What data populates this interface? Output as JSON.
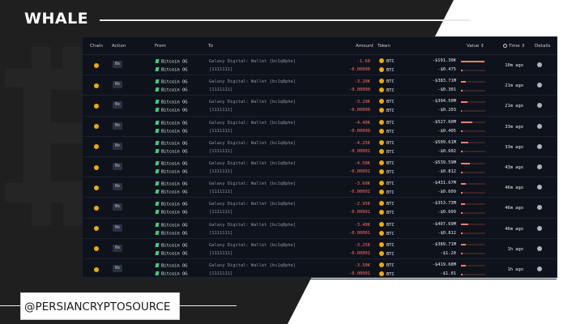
{
  "brand": "WHALE",
  "handle": "@PERSIANCRYPTOSOURCE",
  "columns": {
    "chain": "Chain",
    "action": "Action",
    "from": "From",
    "to": "To",
    "amount": "Amount",
    "token": "Token",
    "value": "Value ⇕",
    "time": "Time ⇕",
    "details": "Details"
  },
  "colors": {
    "accent_btc": "#f2a900",
    "negative": "#ff6b6b",
    "panel": "#0e131b"
  },
  "rows": [
    {
      "action": "0x",
      "from1": "Bitcoin OG",
      "from2": "Bitcoin OG",
      "to1": "Galaxy Digital: Wallet [bc1q8phe]",
      "to2": "[1111111]",
      "amt1": "-1.60",
      "amt2": "-0.00000",
      "tok1": "BTC",
      "tok2": "BTC",
      "val1": "-$191.30K",
      "val2": "-$0.475",
      "bar1": 0.95,
      "bar2": 0.05,
      "time": "10m ago"
    },
    {
      "action": "0x",
      "from1": "Bitcoin OG",
      "from2": "Bitcoin OG",
      "to1": "Galaxy Digital: Wallet [bc1q8phe]",
      "to2": "[1111111]",
      "amt1": "-3.20K",
      "amt2": "-0.00000",
      "tok1": "BTC",
      "tok2": "BTC",
      "val1": "-$383.71M",
      "val2": "-$0.301",
      "bar1": 0.2,
      "bar2": 0.05,
      "time": "21m ago"
    },
    {
      "action": "0x",
      "from1": "Bitcoin OG",
      "from2": "Bitcoin OG",
      "to1": "Galaxy Digital: Wallet [bc1q8phe]",
      "to2": "[1111111]",
      "amt1": "-3.29K",
      "amt2": "-0.00000",
      "tok1": "BTC",
      "tok2": "BTC",
      "val1": "-$394.50M",
      "val2": "-$0.203",
      "bar1": 0.25,
      "bar2": 0.04,
      "time": "21m ago"
    },
    {
      "action": "0x",
      "from1": "Bitcoin OG",
      "from2": "Bitcoin OG",
      "to1": "Galaxy Digital: Wallet [bc1q8phe]",
      "to2": "[1111111]",
      "amt1": "-4.40K",
      "amt2": "-0.00000",
      "tok1": "BTC",
      "tok2": "BTC",
      "val1": "-$527.60M",
      "val2": "-$0.405",
      "bar1": 0.45,
      "bar2": 0.05,
      "time": "33m ago"
    },
    {
      "action": "0x",
      "from1": "Bitcoin OG",
      "from2": "Bitcoin OG",
      "to1": "Galaxy Digital: Wallet [bc1q8phe]",
      "to2": "[1111111]",
      "amt1": "-4.25K",
      "amt2": "-0.00001",
      "tok1": "BTC",
      "tok2": "BTC",
      "val1": "-$509.61M",
      "val2": "-$0.602",
      "bar1": 0.3,
      "bar2": 0.05,
      "time": "33m ago"
    },
    {
      "action": "0x",
      "from1": "Bitcoin OG",
      "from2": "Bitcoin OG",
      "to1": "Galaxy Digital: Wallet [bc1q8phe]",
      "to2": "[1111111]",
      "amt1": "-4.50K",
      "amt2": "-0.00001",
      "tok1": "BTC",
      "tok2": "BTC",
      "val1": "-$539.59M",
      "val2": "-$0.812",
      "bar1": 0.35,
      "bar2": 0.05,
      "time": "43m ago"
    },
    {
      "action": "0x",
      "from1": "Bitcoin OG",
      "from2": "Bitcoin OG",
      "to1": "Galaxy Digital: Wallet [bc1q8phe]",
      "to2": "[1111111]",
      "amt1": "-3.60K",
      "amt2": "-0.00001",
      "tok1": "BTC",
      "tok2": "BTC",
      "val1": "-$431.67M",
      "val2": "-$0.609",
      "bar1": 0.2,
      "bar2": 0.05,
      "time": "46m ago"
    },
    {
      "action": "0x",
      "from1": "Bitcoin OG",
      "from2": "Bitcoin OG",
      "to1": "Galaxy Digital: Wallet [bc1q8phe]",
      "to2": "[1111111]",
      "amt1": "-2.95K",
      "amt2": "-0.00001",
      "tok1": "BTC",
      "tok2": "BTC",
      "val1": "-$353.73M",
      "val2": "-$0.609",
      "bar1": 0.15,
      "bar2": 0.05,
      "time": "46m ago"
    },
    {
      "action": "0x",
      "from1": "Bitcoin OG",
      "from2": "Bitcoin OG",
      "to1": "Galaxy Digital: Wallet [bc1q8phe]",
      "to2": "[1111111]",
      "amt1": "-3.40K",
      "amt2": "-0.00001",
      "tok1": "BTC",
      "tok2": "BTC",
      "val1": "-$407.69M",
      "val2": "-$0.812",
      "bar1": 0.3,
      "bar2": 0.05,
      "time": "46m ago"
    },
    {
      "action": "0x",
      "from1": "Bitcoin OG",
      "from2": "Bitcoin OG",
      "to1": "Galaxy Digital: Wallet [bc1q8phe]",
      "to2": "[1111111]",
      "amt1": "-3.25K",
      "amt2": "-0.00001",
      "tok1": "BTC",
      "tok2": "BTC",
      "val1": "-$389.71M",
      "val2": "-$1.20",
      "bar1": 0.2,
      "bar2": 0.05,
      "time": "1h ago"
    },
    {
      "action": "0x",
      "from1": "Bitcoin OG",
      "from2": "Bitcoin OG",
      "to1": "Galaxy Digital: Wallet [bc1q8phe]",
      "to2": "[1111111]",
      "amt1": "-3.50K",
      "amt2": "-0.00001",
      "tok1": "BTC",
      "tok2": "BTC",
      "val1": "-$419.68M",
      "val2": "-$1.01",
      "bar1": 0.2,
      "bar2": 0.05,
      "time": "1h ago"
    }
  ]
}
